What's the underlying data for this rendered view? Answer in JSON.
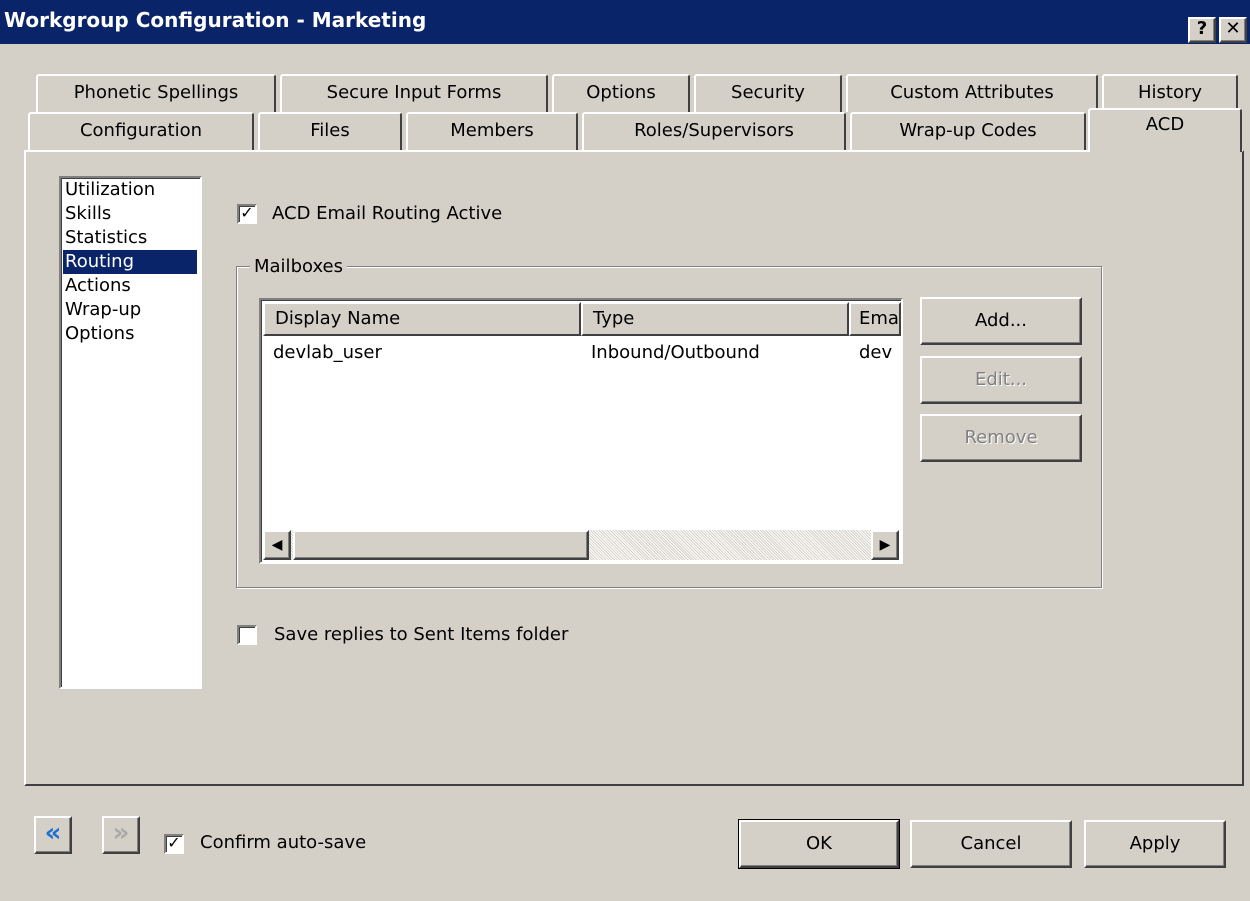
{
  "window": {
    "title": "Workgroup Configuration - Marketing",
    "help_glyph": "?",
    "close_glyph": "✕"
  },
  "tabs_back": [
    "Phonetic Spellings",
    "Secure Input Forms",
    "Options",
    "Security",
    "Custom Attributes",
    "History"
  ],
  "tabs_front": [
    "Configuration",
    "Files",
    "Members",
    "Roles/Supervisors",
    "Wrap-up Codes",
    "ACD"
  ],
  "active_tab": "ACD",
  "sidebar": {
    "items": [
      "Utilization",
      "Skills",
      "Statistics",
      "Routing",
      "Actions",
      "Wrap-up",
      "Options"
    ],
    "selected": "Routing"
  },
  "routing": {
    "email_routing_label": "ACD Email Routing Active",
    "email_routing_checked": true,
    "mailboxes_label": "Mailboxes",
    "columns": [
      "Display Name",
      "Type",
      "Ema"
    ],
    "rows": [
      [
        "devlab_user",
        "Inbound/Outbound",
        "dev"
      ]
    ],
    "add_label": "Add...",
    "edit_label": "Edit...",
    "remove_label": "Remove",
    "save_replies_label": "Save replies to Sent Items folder",
    "save_replies_checked": false
  },
  "footer": {
    "back_glyph": "«",
    "forward_glyph": "»",
    "confirm_label": "Confirm auto-save",
    "confirm_checked": true,
    "ok_label": "OK",
    "cancel_label": "Cancel",
    "apply_label": "Apply"
  },
  "colors": {
    "titlebar": "#0a246a",
    "face": "#d4d0c8",
    "selection": "#0a246a",
    "nav_back_arrow": "#1f6fd0"
  }
}
